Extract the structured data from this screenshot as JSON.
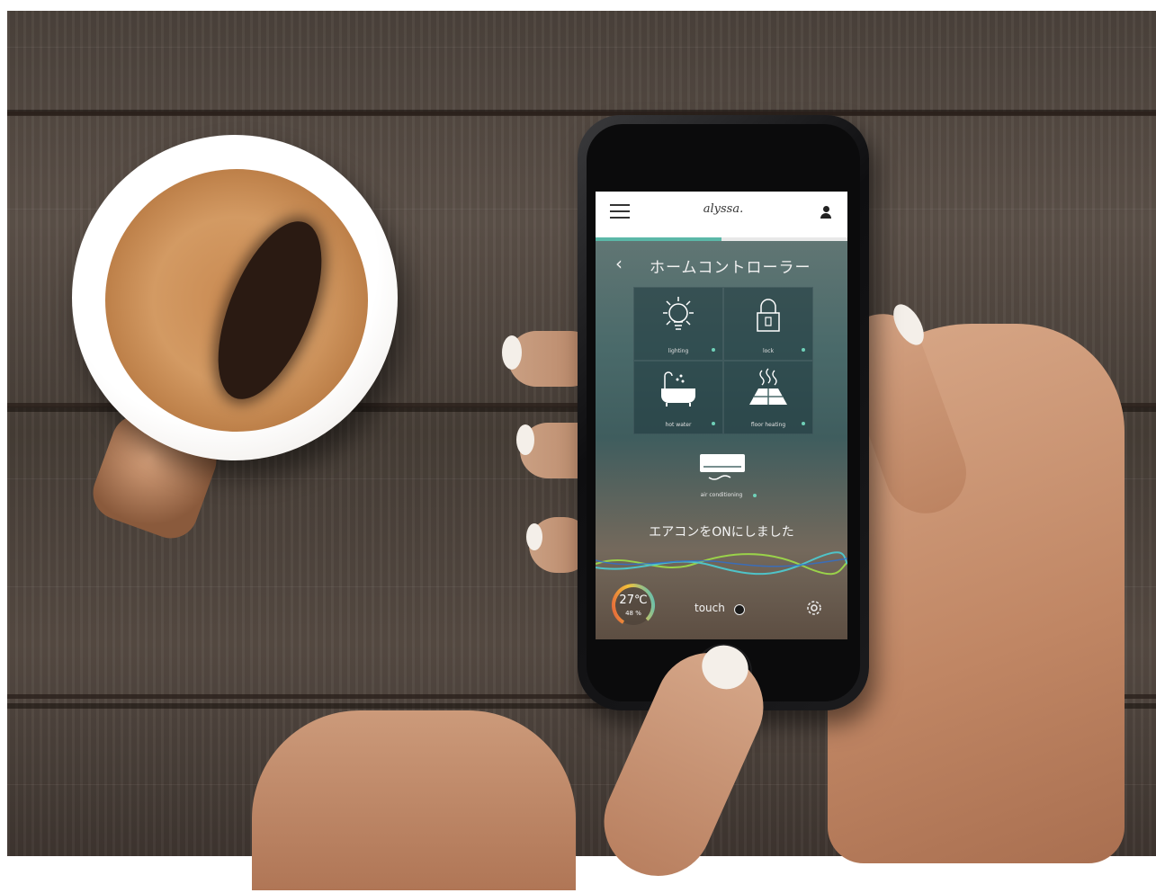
{
  "app": {
    "logo": "alyssa.",
    "page_title": "ホームコントローラー",
    "progress_fraction": 0.5,
    "accent_color": "#5bb8a8"
  },
  "tiles": [
    {
      "label": "lighting",
      "icon": "bulb-icon"
    },
    {
      "label": "lock",
      "icon": "lock-icon"
    },
    {
      "label": "hot water",
      "icon": "bathtub-icon"
    },
    {
      "label": "floor heating",
      "icon": "floor-heating-icon"
    },
    {
      "label": "air conditioning",
      "icon": "air-conditioner-icon"
    }
  ],
  "status_message": "エアコンをONにしました",
  "footer": {
    "temperature": "27℃",
    "humidity": "48 %",
    "touch_label": "touch"
  }
}
